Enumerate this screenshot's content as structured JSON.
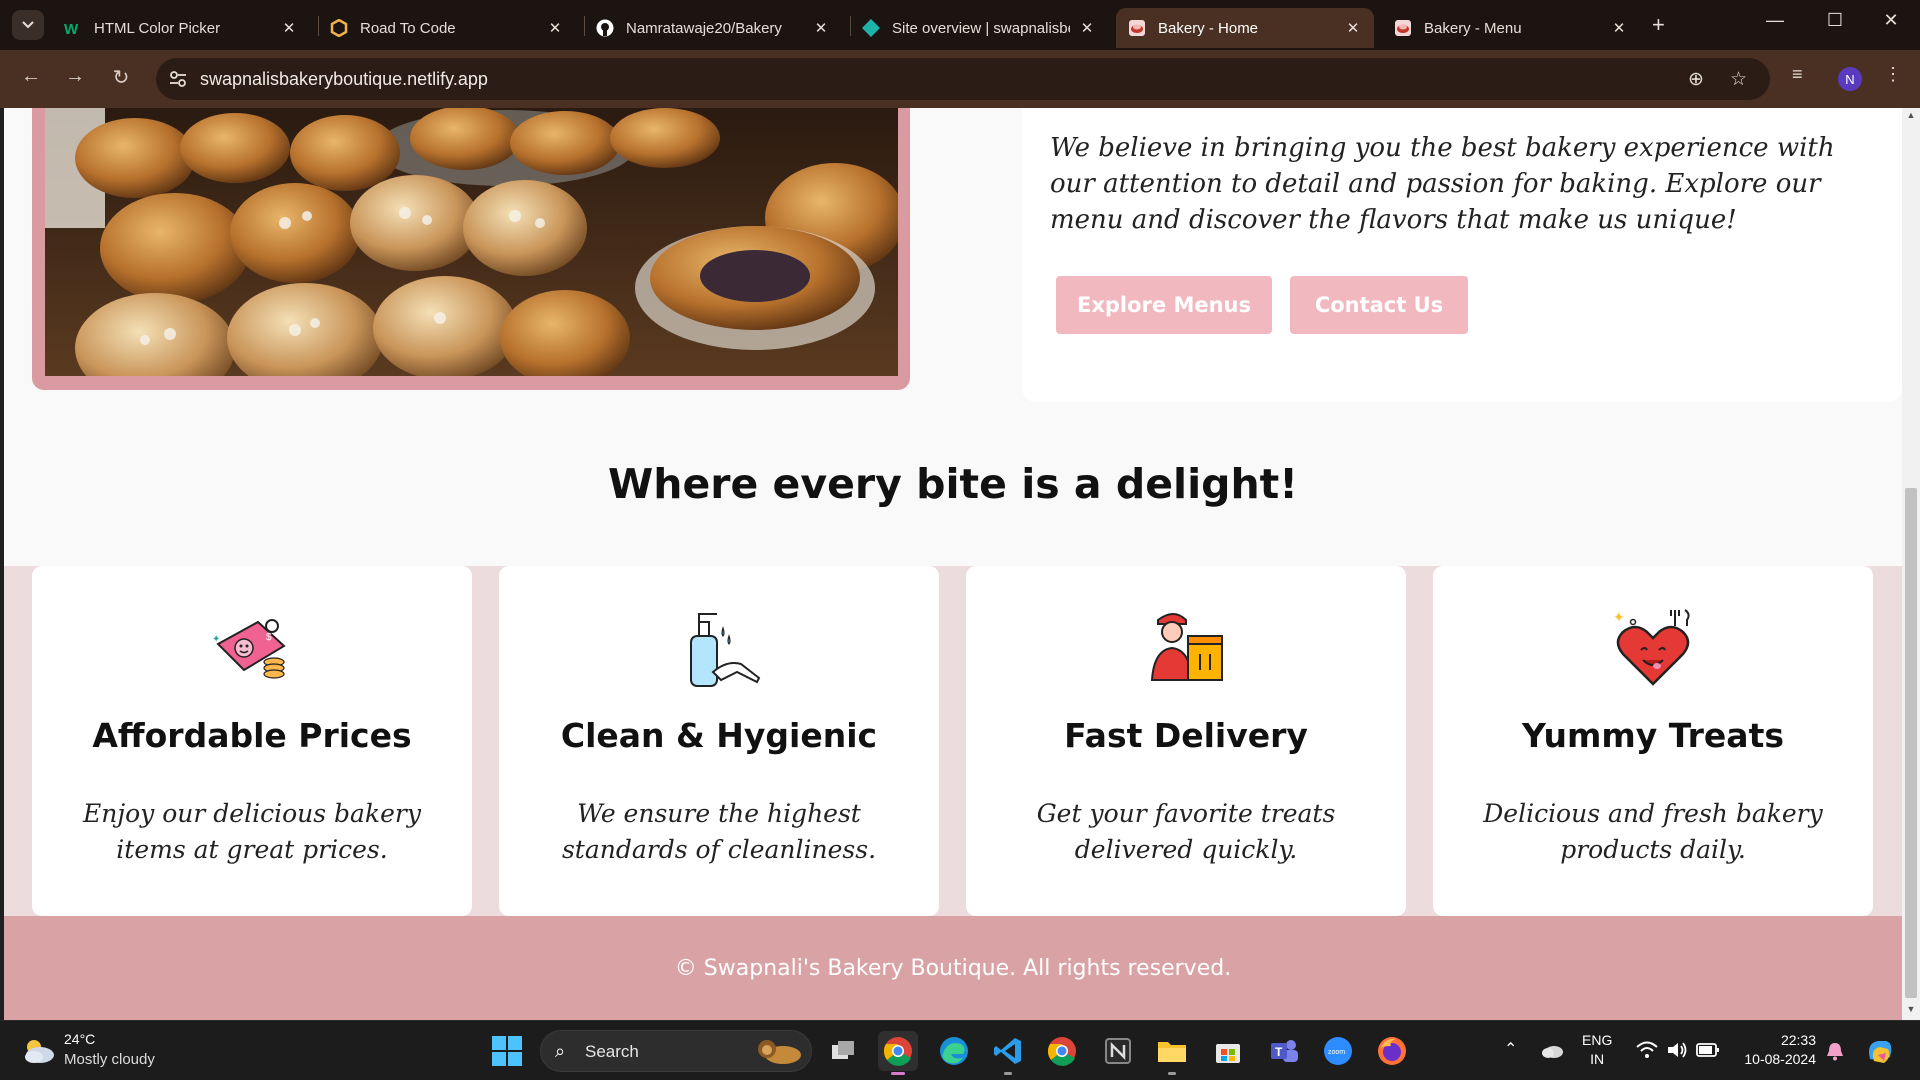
{
  "browser": {
    "tab_search_icon": "chevron-down-icon",
    "tabs": [
      {
        "title": "HTML Color Picker",
        "favicon": "w3schools-icon",
        "active": false
      },
      {
        "title": "Road To Code",
        "favicon": "hexagon-icon",
        "active": false
      },
      {
        "title": "Namratawaje20/Bakery",
        "favicon": "github-icon",
        "active": false
      },
      {
        "title": "Site overview | swapnalisbe",
        "favicon": "netlify-icon",
        "active": false
      },
      {
        "title": "Bakery - Home",
        "favicon": "bakery-icon",
        "active": true
      },
      {
        "title": "Bakery - Menu",
        "favicon": "bakery-icon",
        "active": false
      }
    ],
    "url": "swapnalisbakeryboutique.netlify.app",
    "profile_initial": "N",
    "theme": {
      "tabstrip": "#1c1410",
      "toolbar": "#4a3022"
    }
  },
  "page": {
    "hero": {
      "tagline": "We believe in bringing you the best bakery experience with our attention to detail and passion for baking. Explore our menu and discover the flavors that make us unique!",
      "explore_button": "Explore Menus",
      "contact_button": "Contact Us"
    },
    "section_heading": "Where every bite is a delight!",
    "features": [
      {
        "title": "Affordable Prices",
        "description": "Enjoy our delicious bakery items at great prices.",
        "icon": "price-tag-icon"
      },
      {
        "title": "Clean & Hygienic",
        "description": "We ensure the highest standards of cleanliness.",
        "icon": "hand-wash-icon"
      },
      {
        "title": "Fast Delivery",
        "description": "Get your favorite treats delivered quickly.",
        "icon": "delivery-person-icon"
      },
      {
        "title": "Yummy Treats",
        "description": "Delicious and fresh bakery products daily.",
        "icon": "yummy-heart-icon"
      }
    ],
    "footer": "© Swapnali's Bakery Boutique. All rights reserved.",
    "colors": {
      "accent_pink": "#f2b8c0",
      "frame_pink": "#d99aa2",
      "band_pink": "#ecdcdd",
      "footer_pink": "#d9a3a6"
    }
  },
  "taskbar": {
    "weather": {
      "temp": "24°C",
      "condition": "Mostly cloudy"
    },
    "search_label": "Search",
    "lang_line1": "ENG",
    "lang_line2": "IN",
    "time": "22:33",
    "date": "10-08-2024"
  }
}
